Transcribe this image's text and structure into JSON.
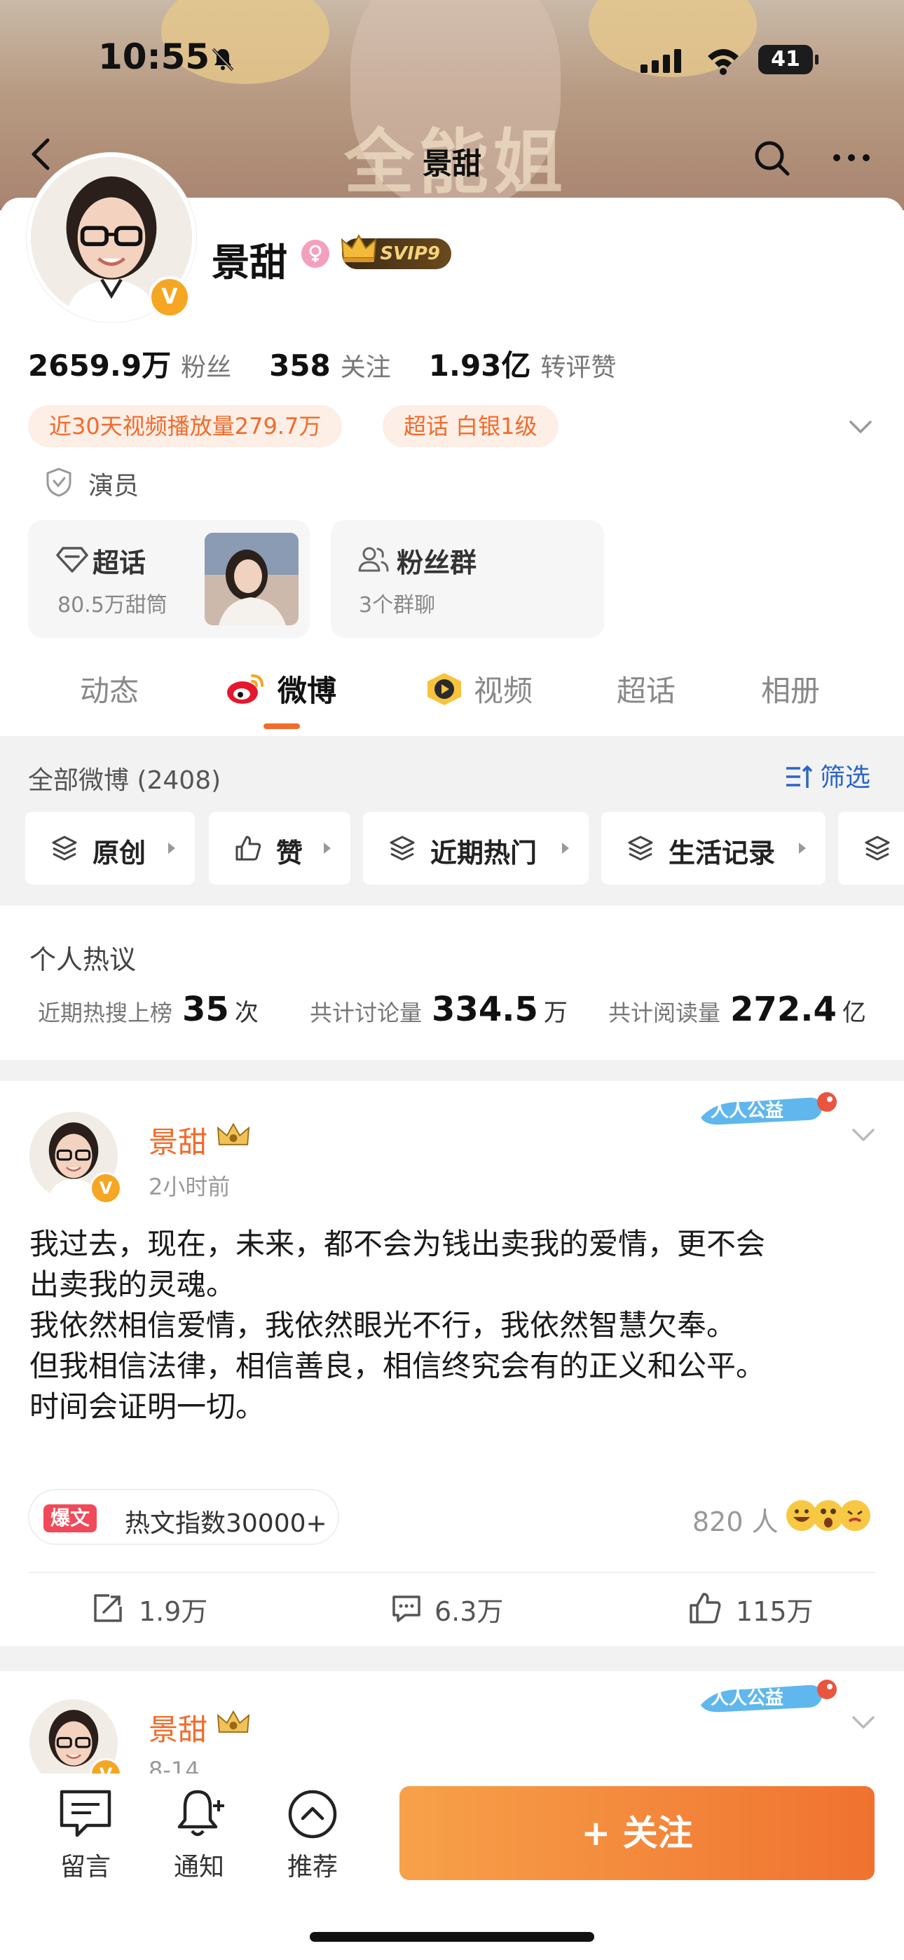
{
  "status_bar": {
    "time": "10:55",
    "battery": "41"
  },
  "nav": {
    "title": "景甜"
  },
  "banner": {
    "text": "全能姐"
  },
  "profile": {
    "name": "景甜",
    "vip_badge": "SVIP9",
    "verified_mark": "V",
    "stats": [
      {
        "value": "2659.9万",
        "label": "粉丝"
      },
      {
        "value": "358",
        "label": "关注"
      },
      {
        "value": "1.93亿",
        "label": "转评赞"
      }
    ],
    "tags": [
      "近30天视频播放量279.7万",
      "超话 白银1级"
    ],
    "occupation": "演员",
    "feature_cards": [
      {
        "title": "超话",
        "subtitle": "80.5万甜筒"
      },
      {
        "title": "粉丝群",
        "subtitle": "3个群聊"
      }
    ]
  },
  "tabs": [
    "动态",
    "微博",
    "视频",
    "超话",
    "相册"
  ],
  "active_tab": "微博",
  "filter": {
    "all_label": "全部微博 (2408)",
    "filter_button": "筛选",
    "chips": [
      "原创",
      "赞",
      "近期热门",
      "生活记录",
      ""
    ]
  },
  "hot_discussion": {
    "title": "个人热议",
    "items": [
      {
        "label": "近期热搜上榜",
        "value": "35",
        "unit": "次"
      },
      {
        "label": "共计讨论量",
        "value": "334.5",
        "unit": "万"
      },
      {
        "label": "共计阅读量",
        "value": "272.4",
        "unit": "亿"
      }
    ]
  },
  "posts": [
    {
      "author": "景甜",
      "time": "2小时前",
      "charity_badge": "人人公益",
      "lines": [
        "我过去，现在，未来，都不会为钱出卖我的爱情，更不会",
        "出卖我的灵魂。",
        "我依然相信爱情，我依然眼光不行，我依然智慧欠奉。",
        "但我相信法律，相信善良，相信终究会有的正义和公平。",
        "时间会证明一切。"
      ],
      "hot_badge": "爆文",
      "hot_index": "热文指数30000+",
      "reaction_count": "820 人",
      "reposts": "1.9万",
      "comments": "6.3万",
      "likes": "115万"
    },
    {
      "author": "景甜",
      "time": "8-14",
      "charity_badge": "人人公益"
    }
  ],
  "bottom_bar": {
    "items": [
      "留言",
      "通知",
      "推荐"
    ],
    "follow_button": "+ 关注"
  },
  "colors": {
    "accent": "#f26b2a",
    "link": "#2a66c7",
    "name": "#f26b2a"
  }
}
